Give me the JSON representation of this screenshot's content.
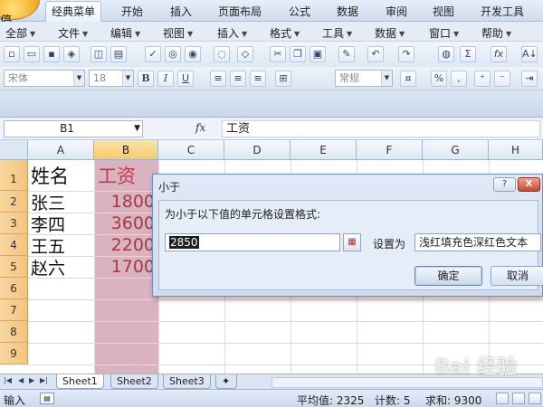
{
  "app": {
    "corner_text": "停"
  },
  "ribbon_tabs": [
    {
      "label": "经典菜单",
      "active": true
    },
    {
      "label": "开始",
      "active": false
    },
    {
      "label": "插入",
      "active": false
    },
    {
      "label": "页面布局",
      "active": false
    },
    {
      "label": "公式",
      "active": false
    },
    {
      "label": "数据",
      "active": false
    },
    {
      "label": "审阅",
      "active": false
    },
    {
      "label": "视图",
      "active": false
    },
    {
      "label": "开发工具",
      "active": false
    }
  ],
  "menus": [
    {
      "label": "全部"
    },
    {
      "label": "文件"
    },
    {
      "label": "编辑"
    },
    {
      "label": "视图"
    },
    {
      "label": "插入"
    },
    {
      "label": "格式"
    },
    {
      "label": "工具"
    },
    {
      "label": "数据"
    },
    {
      "label": "窗口"
    },
    {
      "label": "帮助"
    }
  ],
  "toolbar": {
    "font_name": "宋体",
    "font_size": "18",
    "bold": "B",
    "italic": "I",
    "underline": "U",
    "number_format": "常规",
    "percent": "%",
    "sigma": "Σ",
    "fx": "fx",
    "sort": "A↓"
  },
  "formula_bar": {
    "name_box": "B1",
    "fx_label": "fx",
    "content": "工资"
  },
  "grid": {
    "columns": [
      "A",
      "B",
      "C",
      "D",
      "E",
      "F",
      "G",
      "H"
    ],
    "selected_column": "B",
    "rows": [
      "1",
      "2",
      "3",
      "4",
      "5",
      "6",
      "7",
      "8",
      "9"
    ],
    "col_a": [
      "姓名",
      "张三",
      "李四",
      "王五",
      "赵六"
    ],
    "col_b": [
      "工资",
      "1800",
      "3600",
      "2200",
      "1700"
    ]
  },
  "dialog": {
    "title": "小于",
    "prompt": "为小于以下值的单元格设置格式:",
    "value": "2850",
    "set_label": "设置为",
    "format": "浅红填充色深红色文本",
    "ok_label": "确定",
    "cancel_label": "取消",
    "help": "?",
    "close": "X"
  },
  "sheets": [
    {
      "label": "Sheet1",
      "active": true
    },
    {
      "label": "Sheet2",
      "active": false
    },
    {
      "label": "Sheet3",
      "active": false
    }
  ],
  "status_bar": {
    "mode": "输入",
    "average": "平均值: 2325",
    "count": "计数: 5",
    "sum": "求和: 9300"
  },
  "watermark": "Bai 经验"
}
